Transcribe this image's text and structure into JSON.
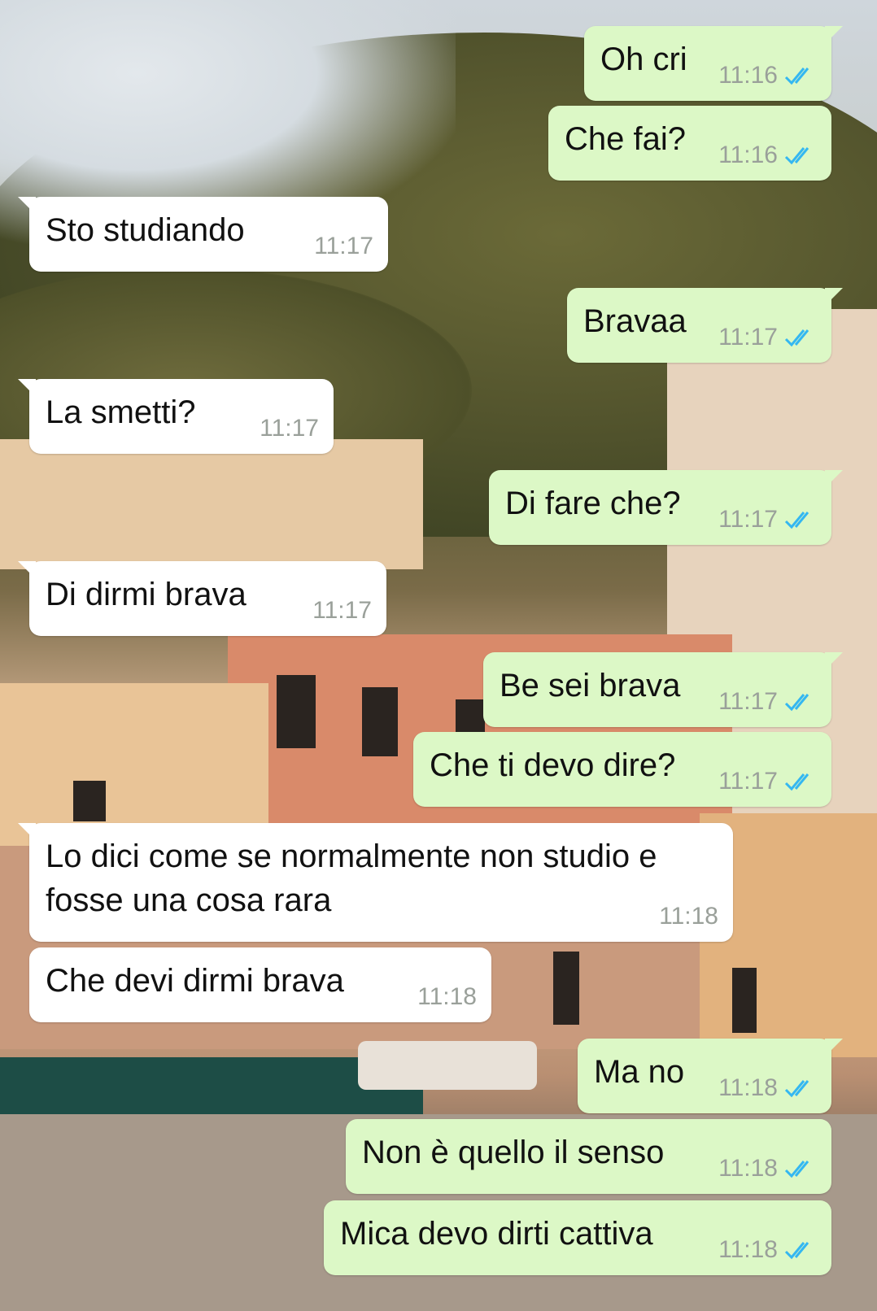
{
  "colors": {
    "outgoing_bubble": "#dcf8c6",
    "incoming_bubble": "#ffffff",
    "time_text": "#9aa09a",
    "read_ticks": "#34b7f1"
  },
  "icons": {
    "read_receipt": "double-check-icon"
  },
  "messages": [
    {
      "direction": "out",
      "text": "Oh cri",
      "time": "11:16"
    },
    {
      "direction": "out",
      "text": "Che fai?",
      "time": "11:16"
    },
    {
      "direction": "in",
      "text": "Sto studiando",
      "time": "11:17"
    },
    {
      "direction": "out",
      "text": "Bravaa",
      "time": "11:17"
    },
    {
      "direction": "in",
      "text": "La smetti?",
      "time": "11:17"
    },
    {
      "direction": "out",
      "text": "Di fare che?",
      "time": "11:17"
    },
    {
      "direction": "in",
      "text": "Di dirmi brava",
      "time": "11:17"
    },
    {
      "direction": "out",
      "text": "Be sei brava",
      "time": "11:17"
    },
    {
      "direction": "out",
      "text": "Che ti devo dire?",
      "time": "11:17"
    },
    {
      "direction": "in",
      "text": "Lo dici come se normalmente non studio e fosse una cosa rara",
      "time": "11:18"
    },
    {
      "direction": "in",
      "text": "Che devi dirmi brava",
      "time": "11:18"
    },
    {
      "direction": "out",
      "text": "Ma no",
      "time": "11:18"
    },
    {
      "direction": "out",
      "text": "Non è quello il senso",
      "time": "11:18"
    },
    {
      "direction": "out",
      "text": "Mica devo dirti cattiva",
      "time": "11:18"
    }
  ]
}
